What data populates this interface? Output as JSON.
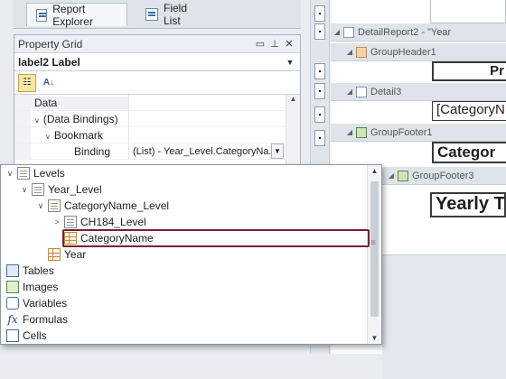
{
  "tabs": [
    {
      "label": "Report Explorer",
      "icon": "report-explorer-icon"
    },
    {
      "label": "Field List",
      "icon": "field-list-icon"
    }
  ],
  "property_grid": {
    "title": "Property Grid",
    "selected_object": "label2   Label",
    "rows": [
      {
        "name": "Data",
        "value": ""
      },
      {
        "name": "(Data Bindings)",
        "value": ""
      },
      {
        "name": "Bookmark",
        "value": ""
      },
      {
        "name": "Binding",
        "value": "(List) - Year_Level.CategoryNa..."
      }
    ]
  },
  "designer": {
    "bands": [
      {
        "label": "DetailReport2 - \"Year"
      },
      {
        "label": "GroupHeader1"
      },
      {
        "label": "Detail3"
      },
      {
        "label": "GroupFooter1"
      },
      {
        "label": "GroupFooter3"
      }
    ],
    "cells": [
      "Pr",
      "[CategoryN",
      "Categor",
      "Yearly T"
    ]
  },
  "tree": {
    "items": [
      {
        "label": "Levels"
      },
      {
        "label": "Year_Level"
      },
      {
        "label": "CategoryName_Level"
      },
      {
        "label": "CH184_Level"
      },
      {
        "label": "CategoryName"
      },
      {
        "label": "Year"
      },
      {
        "label": "Tables"
      },
      {
        "label": "Images"
      },
      {
        "label": "Variables"
      },
      {
        "label": "Formulas"
      },
      {
        "label": "Cells"
      }
    ]
  },
  "colors": {
    "selection_border": "#7a1f2e",
    "active_tool": "#fbe6a6"
  }
}
